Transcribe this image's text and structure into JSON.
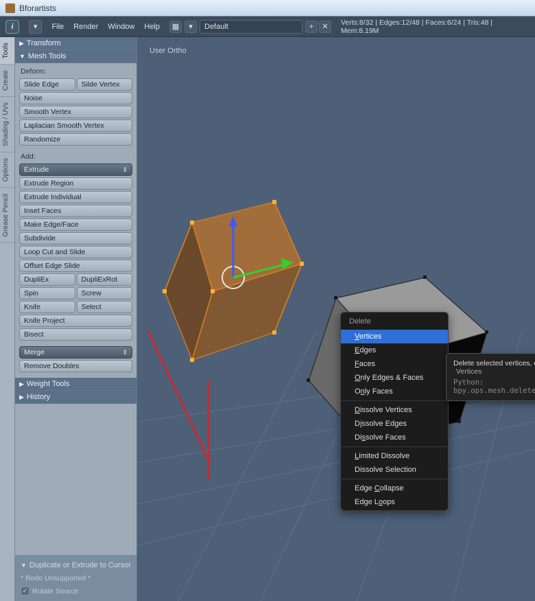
{
  "window": {
    "title": "Bforartists"
  },
  "menubar": {
    "items": [
      "File",
      "Render",
      "Window",
      "Help"
    ],
    "layout": "Default",
    "stats": "Verts:8/32 | Edges:12/48 | Faces:6/24 | Tris:48 | Mem:8.19M"
  },
  "vtabs": [
    "Tools",
    "Create",
    "Shading / UVs",
    "Options",
    "Grease Pencil"
  ],
  "sidebar": {
    "transform_hdr": "Transform",
    "mesh_hdr": "Mesh Tools",
    "deform_label": "Deform:",
    "slide_edge": "Slide Edge",
    "slide_vertex": "Silde Vertex",
    "noise": "Noise",
    "smooth_vertex": "Smooth Vertex",
    "laplacian": "Laplacian Smooth Vertex",
    "randomize": "Randomize",
    "add_label": "Add:",
    "extrude_dd": "Extrude",
    "extrude_region": "Extrude Region",
    "extrude_individual": "Extrude Individual",
    "inset_faces": "Inset Faces",
    "make_edge_face": "Make Edge/Face",
    "subdivide": "Subdivide",
    "loop_cut": "Loop Cut and Slide",
    "offset_edge": "Offset Edge Slide",
    "dupliex": "DupliEx",
    "dupliexrot": "DupliExRot",
    "spin": "Spin",
    "screw": "Screw",
    "knife": "Knife",
    "select": "Select",
    "knife_project": "Knife Project",
    "bisect": "Bisect",
    "merge_dd": "Merge",
    "remove_doubles": "Remove Doubles",
    "weight_tools": "Weight Tools",
    "history": "History",
    "bottom_hdr": "Duplicate or Extrude to Cursor",
    "redo_txt": "* Redo Unsupported *",
    "rotate_src": "Rotate Source"
  },
  "viewport": {
    "label": "User Ortho"
  },
  "context_menu": {
    "title": "Delete",
    "items": [
      {
        "label": "Vertices",
        "u": "V",
        "hover": true
      },
      {
        "label": "Edges",
        "u": "E"
      },
      {
        "label": "Faces",
        "u": "F"
      },
      {
        "label": "Only Edges & Faces",
        "u": "O"
      },
      {
        "label": "Only Faces",
        "u": "n",
        "pre": "O"
      }
    ],
    "group2": [
      {
        "label": "Dissolve Vertices",
        "u": "D"
      },
      {
        "label": "Dissolve Edges",
        "u": "i",
        "pre": "D"
      },
      {
        "label": "Dissolve Faces",
        "u": "s",
        "pre": "Di"
      }
    ],
    "group3": [
      {
        "label": "Limited Dissolve",
        "u": "L"
      },
      {
        "label": "Dissolve Selection"
      }
    ],
    "group4": [
      {
        "label": "Edge Collapse",
        "u": "C",
        "pre": "Edge "
      },
      {
        "label": "Edge Loops",
        "u": "o",
        "pre": "Edge L"
      }
    ]
  },
  "tooltip": {
    "desc": "Delete selected vertices, edges or faces:",
    "val": "Vertices",
    "py": "Python: bpy.ops.mesh.delete(type='VERT')"
  }
}
